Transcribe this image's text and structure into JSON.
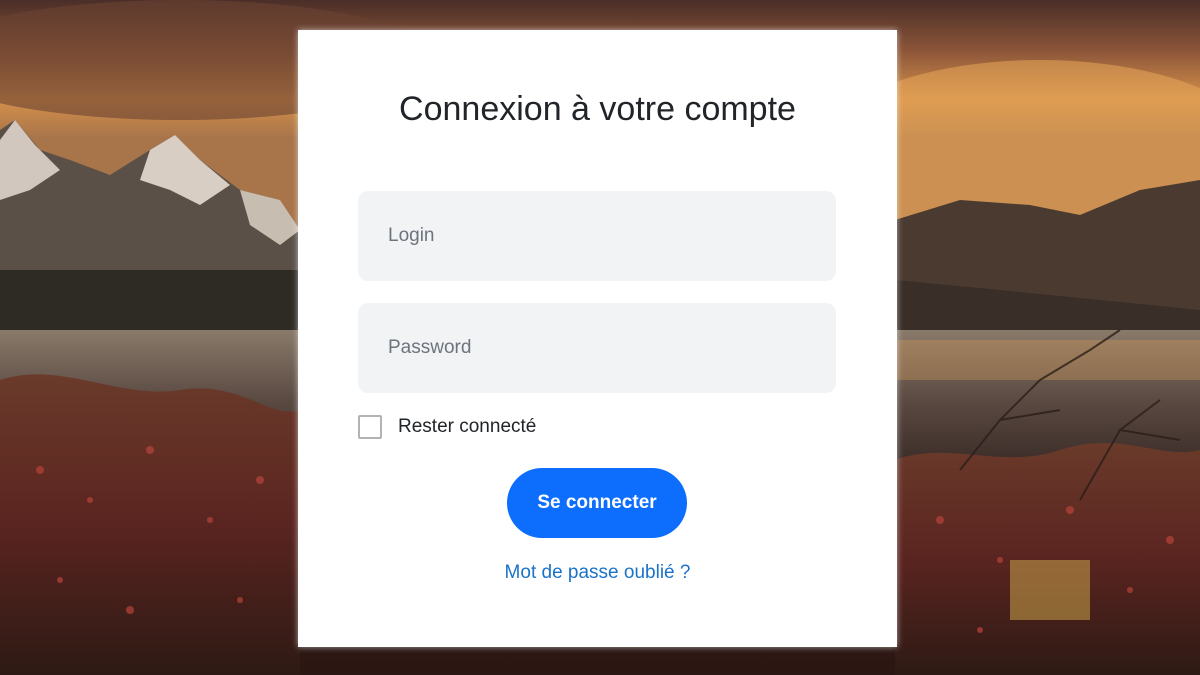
{
  "page": {
    "background_description_colors": {
      "sky": "#d9964f",
      "mountains": "#4a4038",
      "lake": "#7a6a5a",
      "foliage": "#6a2a22"
    }
  },
  "login_form": {
    "title": "Connexion à votre compte",
    "login_field": {
      "placeholder": "Login",
      "value": ""
    },
    "password_field": {
      "placeholder": "Password",
      "value": ""
    },
    "remember_me": {
      "label": "Rester connecté",
      "checked": false
    },
    "submit_label": "Se connecter",
    "forgot_password_label": "Mot de passe oublié ?",
    "colors": {
      "primary_button": "#0d6efd",
      "link": "#1a73c8",
      "input_background": "#f2f3f5",
      "card_background": "#ffffff"
    }
  }
}
